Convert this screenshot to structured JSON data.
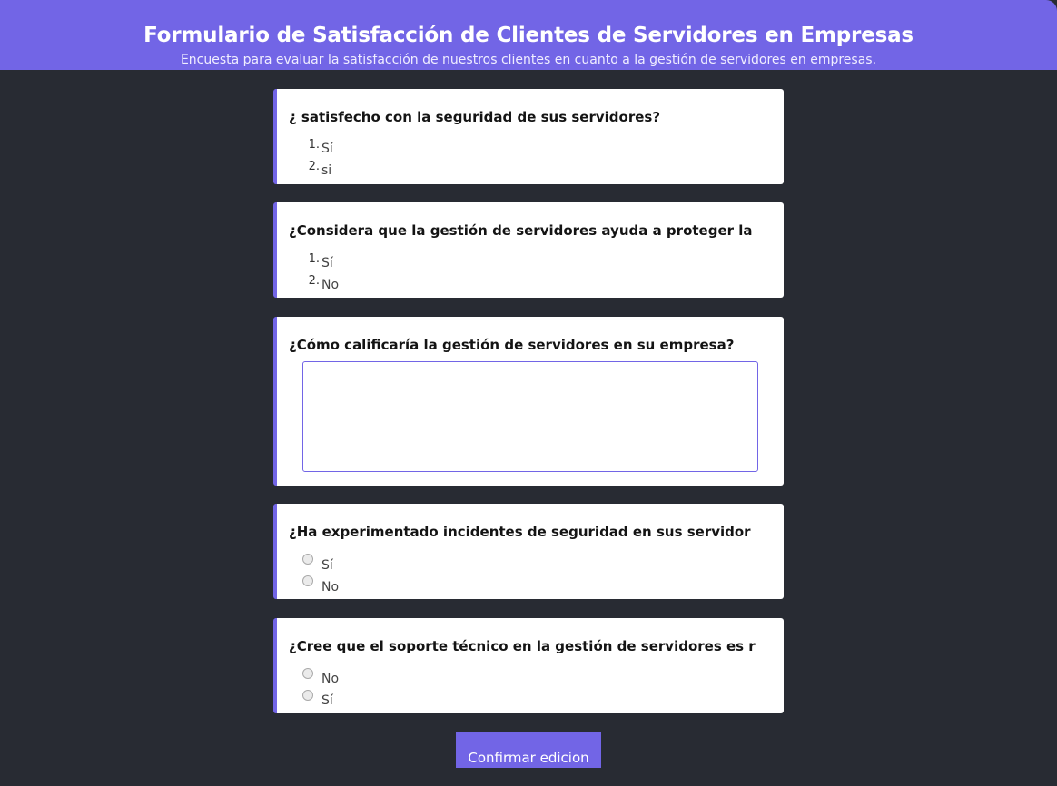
{
  "header": {
    "title": "Formulario de Satisfacción de Clientes de Servidores en Empresas",
    "subtitle": "Encuesta para evaluar la satisfacción de nuestros clientes en cuanto a la gestión de servidores en empresas."
  },
  "questions": [
    {
      "title": "¿ satisfecho con la seguridad de sus servidores?",
      "type": "ordered-list",
      "options": [
        {
          "num": "1.",
          "label": "Sí"
        },
        {
          "num": "2.",
          "label": "si"
        }
      ]
    },
    {
      "title": "¿Considera que la gestión de servidores ayuda a proteger la",
      "type": "ordered-list",
      "options": [
        {
          "num": "1.",
          "label": "Sí"
        },
        {
          "num": "2.",
          "label": "No"
        }
      ]
    },
    {
      "title": "¿Cómo calificaría la gestión de servidores en su empresa?",
      "type": "textarea",
      "value": ""
    },
    {
      "title": "¿Ha experimentado incidentes de seguridad en sus servidor",
      "type": "radio",
      "options": [
        {
          "label": "Sí",
          "checked": false
        },
        {
          "label": "No",
          "checked": false
        }
      ]
    },
    {
      "title": "¿Cree que el soporte técnico en la gestión de servidores es r",
      "type": "radio",
      "options": [
        {
          "label": "No",
          "checked": false
        },
        {
          "label": "Sí",
          "checked": false
        }
      ]
    }
  ],
  "actions": {
    "confirm_label": "Confirmar edicion"
  },
  "colors": {
    "accent": "#7265e6",
    "background": "#282b33",
    "card": "#ffffff"
  }
}
